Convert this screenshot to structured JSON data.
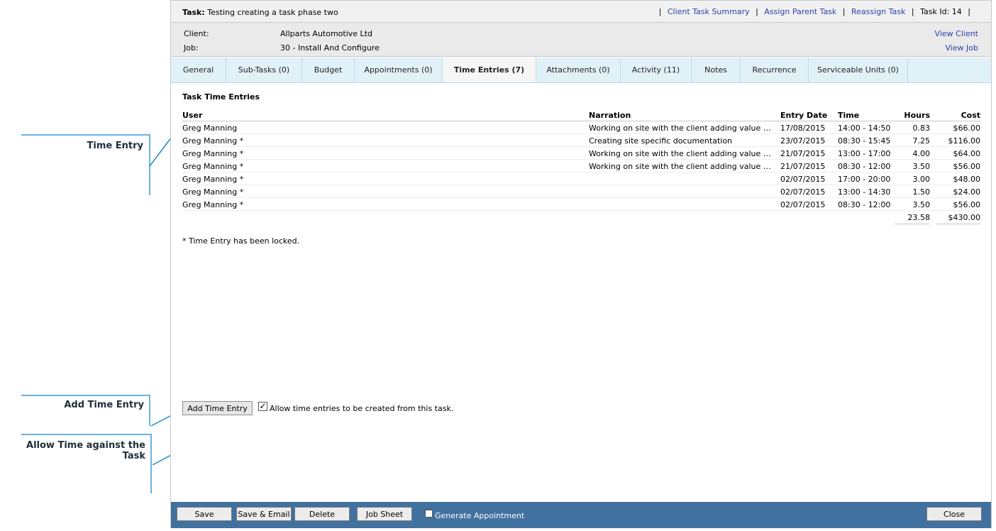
{
  "callouts": {
    "time_entry": "Time Entry",
    "add_time_entry": "Add Time Entry",
    "allow_time": "Allow Time against the Task"
  },
  "header": {
    "task_label": "Task:",
    "task_name": "Testing creating a task phase two",
    "links": [
      "Client Task Summary",
      "Assign Parent Task",
      "Reassign Task"
    ],
    "task_id_label": "Task Id: 14"
  },
  "client_block": {
    "client_label": "Client:",
    "client_value": "Allparts Automotive Ltd",
    "view_client": "View Client",
    "job_label": "Job:",
    "job_value": "30 - Install And Configure",
    "view_job": "View Job"
  },
  "tabs": [
    {
      "label": "General"
    },
    {
      "label": "Sub-Tasks (0)"
    },
    {
      "label": "Budget"
    },
    {
      "label": "Appointments (0)"
    },
    {
      "label": "Time Entries (7)",
      "active": true
    },
    {
      "label": "Attachments (0)"
    },
    {
      "label": "Activity (11)"
    },
    {
      "label": "Notes"
    },
    {
      "label": "Recurrence"
    },
    {
      "label": "Serviceable Units (0)"
    }
  ],
  "time_entries": {
    "title": "Task Time Entries",
    "columns": {
      "user": "User",
      "narration": "Narration",
      "date": "Entry Date",
      "time": "Time",
      "hours": "Hours",
      "cost": "Cost"
    },
    "rows": [
      {
        "user": "Greg Manning",
        "narration": "Working on site with the client adding value to the...",
        "date": "17/08/2015",
        "time": "14:00 - 14:50",
        "hours": "0.83",
        "cost": "$66.00"
      },
      {
        "user": "Greg Manning *",
        "narration": "Creating site specific documentation",
        "date": "23/07/2015",
        "time": "08:30 - 15:45",
        "hours": "7.25",
        "cost": "$116.00"
      },
      {
        "user": "Greg Manning *",
        "narration": "Working on site with the client adding value to the...",
        "date": "21/07/2015",
        "time": "13:00 - 17:00",
        "hours": "4.00",
        "cost": "$64.00"
      },
      {
        "user": "Greg Manning *",
        "narration": "Working on site with the client adding value to the...",
        "date": "21/07/2015",
        "time": "08:30 - 12:00",
        "hours": "3.50",
        "cost": "$56.00"
      },
      {
        "user": "Greg Manning *",
        "narration": "",
        "date": "02/07/2015",
        "time": "17:00 - 20:00",
        "hours": "3.00",
        "cost": "$48.00"
      },
      {
        "user": "Greg Manning *",
        "narration": "",
        "date": "02/07/2015",
        "time": "13:00 - 14:30",
        "hours": "1.50",
        "cost": "$24.00"
      },
      {
        "user": "Greg Manning *",
        "narration": "",
        "date": "02/07/2015",
        "time": "08:30 - 12:00",
        "hours": "3.50",
        "cost": "$56.00"
      }
    ],
    "total_hours": "23.58",
    "total_cost": "$430.00",
    "locked_note": "* Time Entry has been locked."
  },
  "actions": {
    "add_time_entry": "Add Time Entry",
    "allow_label": "Allow time entries to be created from this task.",
    "allow_checked": true
  },
  "footer": {
    "save": "Save",
    "save_email": "Save & Email",
    "delete": "Delete",
    "job_sheet": "Job Sheet",
    "generate_appointment": "Generate Appointment",
    "close": "Close"
  },
  "colors": {
    "callout_line": "#1e8cc8",
    "footer_bg": "#41719f",
    "tab_bg": "#e1f1f8",
    "link": "#2a3fa8"
  }
}
